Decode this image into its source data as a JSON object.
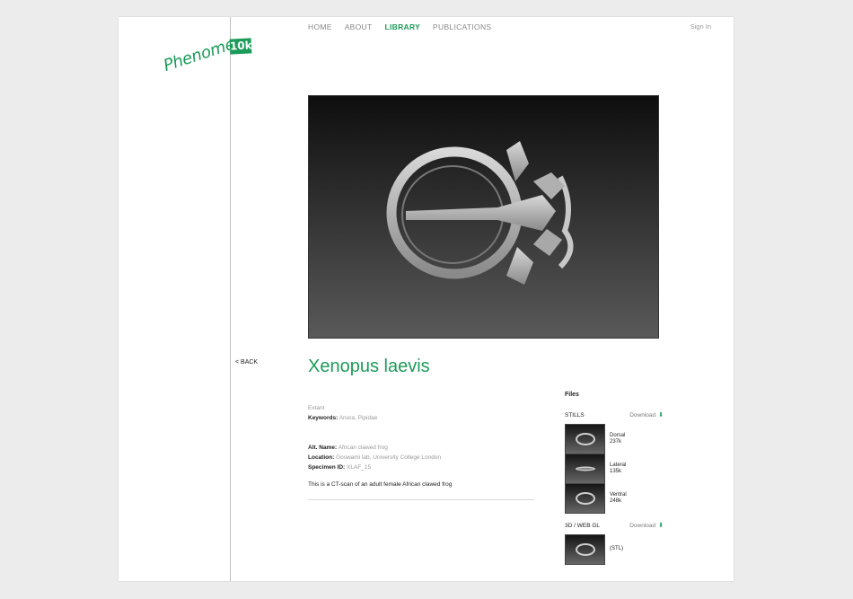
{
  "site": {
    "logo_word": "Phenome",
    "logo_badge": "10k",
    "signin": "Sign In"
  },
  "nav": {
    "items": [
      {
        "label": "HOME"
      },
      {
        "label": "ABOUT"
      },
      {
        "label": "LIBRARY",
        "active": true
      },
      {
        "label": "PUBLICATIONS"
      }
    ]
  },
  "back_label": "< BACK",
  "specimen": {
    "title": "Xenopus laevis",
    "status": "Extant",
    "keywords_label": "Keywords:",
    "keywords_value": "Anura, Pipidae",
    "altname_label": "Alt. Name:",
    "altname_value": "African clawed frog",
    "location_label": "Location:",
    "location_value": "Goswami lab, University College London",
    "specimen_id_label": "Specimen ID:",
    "specimen_id_value": "XLAF_15",
    "description": "This is a CT-scan of an adult female African clawed frog"
  },
  "files": {
    "heading": "Files",
    "stills_label": "STILLS",
    "download_label": "Download",
    "stills": [
      {
        "name": "Dorsal",
        "size": "237k"
      },
      {
        "name": "Lateral",
        "size": "135k"
      },
      {
        "name": "Ventral",
        "size": "248k"
      }
    ],
    "webgl_label": "3D / WEB GL",
    "webgl_file": "(STL)"
  },
  "colors": {
    "accent": "#1c9b5a",
    "background": "#ececec"
  },
  "icons": {
    "download": "download-arrow-icon"
  }
}
